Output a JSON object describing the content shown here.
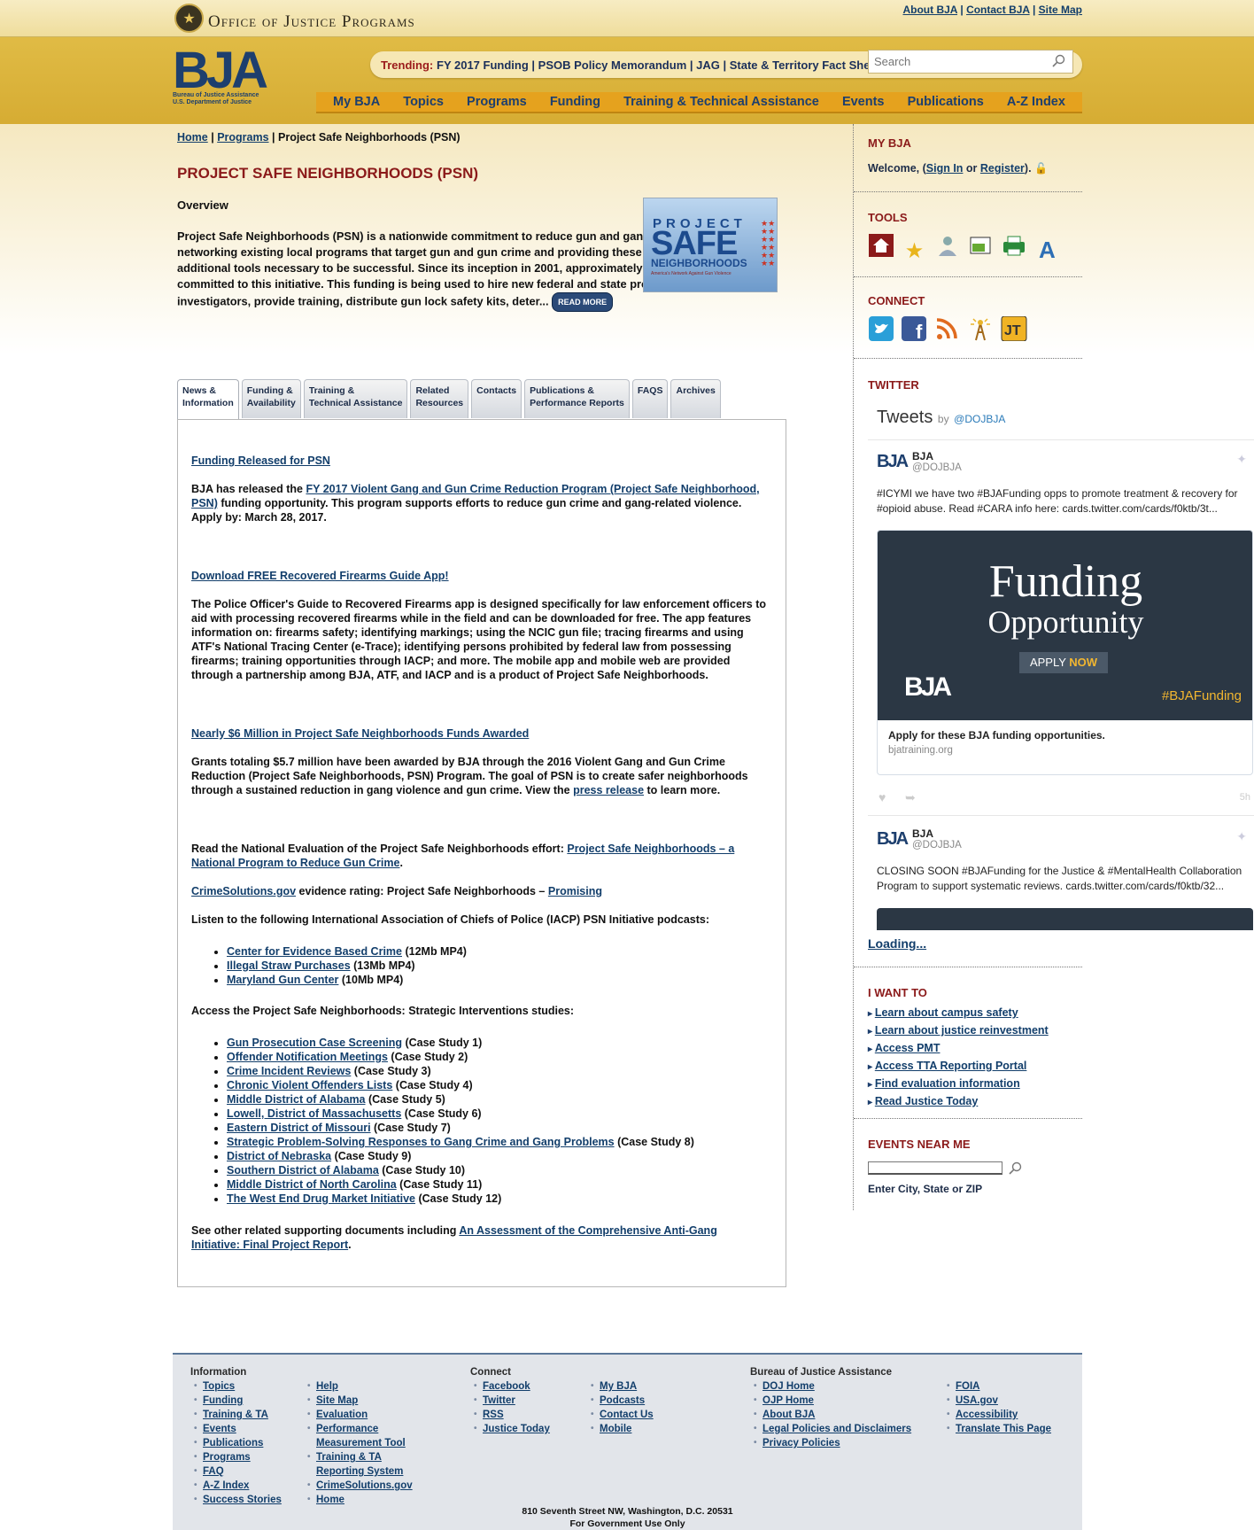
{
  "top": {
    "agency": "Office of Justice Programs",
    "links": [
      "About BJA",
      "Contact BJA",
      "Site Map"
    ]
  },
  "header": {
    "logo": "BJA",
    "logo_sub1": "Bureau of Justice Assistance",
    "logo_sub2": "U.S. Department of Justice",
    "trending_label": "Trending:",
    "trending": [
      "FY 2017 Funding",
      "PSOB Policy Memorandum",
      "JAG",
      "State & Territory Fact Sheets"
    ],
    "search_placeholder": "Search",
    "nav": [
      "My BJA",
      "Topics",
      "Programs",
      "Funding",
      "Training & Technical Assistance",
      "Events",
      "Publications",
      "A-Z Index"
    ]
  },
  "breadcrumb": {
    "home": "Home",
    "programs": "Programs",
    "current": "Project Safe Neighborhoods (PSN)"
  },
  "page_title": "PROJECT SAFE NEIGHBORHOODS (PSN)",
  "overview": {
    "label": "Overview",
    "text": "Project Safe Neighborhoods (PSN) is a nationwide commitment to reduce gun and gang crime in America by networking existing local programs that target gun and gun crime and providing these programs with additional tools necessary to be successful. Since its inception in 2001, approximately $2 billion has been committed to this initiative. This funding is being used to hire new federal and state prosecutors, support investigators, provide training, distribute gun lock safety kits, deter...",
    "read_more": "READ MORE"
  },
  "psn_logo": {
    "line1": "PROJECT",
    "line2": "SAFE",
    "line3": "NEIGHBORHOODS",
    "tagline": "America's Network Against Gun Violence"
  },
  "tabs": [
    {
      "l1": "News &",
      "l2": "Information"
    },
    {
      "l1": "Funding &",
      "l2": "Availability"
    },
    {
      "l1": "Training &",
      "l2": "Technical Assistance"
    },
    {
      "l1": "Related",
      "l2": "Resources"
    },
    {
      "l1": "Contacts",
      "l2": ""
    },
    {
      "l1": "Publications &",
      "l2": "Performance Reports"
    },
    {
      "l1": "FAQS",
      "l2": ""
    },
    {
      "l1": "Archives",
      "l2": ""
    }
  ],
  "news": {
    "item1_title": "Funding Released for PSN",
    "item1_pre": "BJA has released the ",
    "item1_link": "FY 2017 Violent Gang and Gun Crime Reduction Program (Project Safe Neighborhood, PSN)",
    "item1_post": " funding opportunity. This program supports efforts to reduce gun crime and gang-related violence. Apply by: March 28, 2017.",
    "item2_title": "Download FREE Recovered Firearms Guide App!",
    "item2_text": "The Police Officer's Guide to Recovered Firearms app is designed specifically for law enforcement officers to aid with processing recovered firearms while in the field and can be downloaded for free. The app features information on: firearms safety; identifying markings; using the NCIC gun file; tracing firearms and using ATF's National Tracing Center (e-Trace); identifying persons prohibited by federal law from possessing firearms; training opportunities through IACP; and more. The mobile app and mobile web are provided through a partnership among BJA, ATF, and IACP and is a product of Project Safe Neighborhoods.",
    "item3_title": "Nearly $6 Million in Project Safe Neighborhoods Funds Awarded",
    "item3_pre": "Grants totaling $5.7 million have been awarded by BJA through the 2016 Violent Gang and Gun Crime Reduction (Project Safe Neighborhoods, PSN) Program. The goal of PSN is to create safer neighborhoods through a sustained reduction in gang violence and gun crime. View the ",
    "item3_link": "press release",
    "item3_post": " to learn more.",
    "eval_pre": "Read the National Evaluation of the Project Safe Neighborhoods effort: ",
    "eval_link": "Project Safe Neighborhoods – a National Program to Reduce Gun Crime",
    "eval_post": ".",
    "cs_link": "CrimeSolutions.gov",
    "cs_mid": " evidence rating: Project Safe Neighborhoods – ",
    "cs_rating": "Promising",
    "podcast_intro": "Listen to the following International Association of Chiefs of Police (IACP) PSN Initiative podcasts:",
    "podcasts": [
      {
        "link": "Center for Evidence Based Crime",
        "note": " (12Mb MP4)"
      },
      {
        "link": "Illegal Straw Purchases",
        "note": " (13Mb MP4)"
      },
      {
        "link": "Maryland Gun Center",
        "note": " (10Mb MP4)"
      }
    ],
    "studies_intro": "Access the Project Safe Neighborhoods: Strategic Interventions studies:",
    "studies": [
      {
        "link": "Gun Prosecution Case Screening",
        "note": " (Case Study 1)"
      },
      {
        "link": "Offender Notification Meetings",
        "note": " (Case Study 2)"
      },
      {
        "link": "Crime Incident Reviews",
        "note": " (Case Study 3)"
      },
      {
        "link": "Chronic Violent Offenders Lists",
        "note": " (Case Study 4)"
      },
      {
        "link": "Middle District of Alabama",
        "note": " (Case Study 5)"
      },
      {
        "link": "Lowell, District of Massachusetts",
        "note": " (Case Study 6)"
      },
      {
        "link": "Eastern District of Missouri",
        "note": " (Case Study 7)"
      },
      {
        "link": "Strategic Problem-Solving Responses to Gang Crime and Gang Problems",
        "note": " (Case Study 8)"
      },
      {
        "link": "District of Nebraska",
        "note": " (Case Study 9)"
      },
      {
        "link": "Southern District of Alabama",
        "note": " (Case Study 10)"
      },
      {
        "link": "Middle District of North Carolina",
        "note": " (Case Study 11)"
      },
      {
        "link": "The West End Drug Market Initiative",
        "note": " (Case Study 12)"
      }
    ],
    "related_pre": "See other related supporting documents including ",
    "related_link": "An Assessment of the Comprehensive Anti-Gang Initiative: Final Project Report",
    "related_post": "."
  },
  "sidebar": {
    "mybja_title": "MY BJA",
    "welcome": "Welcome, (",
    "sign_in": "Sign In",
    "or": " or ",
    "register": "Register",
    "welcome_end": ").",
    "tools_title": "TOOLS",
    "connect_title": "CONNECT",
    "twitter_title": "TWITTER",
    "tweets_label": "Tweets",
    "tweets_by": "by",
    "tweets_handle": "@DOJBJA",
    "tweet1_name": "BJA",
    "tweet1_handle": "@DOJBJA",
    "tweet1_text": "#ICYMI we have two #BJAFunding opps to promote treatment & recovery for #opioid abuse. Read #CARA info here: cards.twitter.com/cards/f0ktb/3t...",
    "card_title1": "Funding",
    "card_title2": "Opportunity",
    "card_apply": "APPLY ",
    "card_now": "NOW",
    "card_logo": "BJA",
    "card_tag": "#BJAFunding",
    "card_caption": "Apply for these BJA funding opportunities.",
    "card_domain": "bjatraining.org",
    "tweet1_time": "5h",
    "tweet2_name": "BJA",
    "tweet2_handle": "@DOJBJA",
    "tweet2_text": "CLOSING SOON #BJAFunding for the Justice & #MentalHealth Collaboration Program to support systematic reviews. cards.twitter.com/cards/f0ktb/32...",
    "loading": "Loading...",
    "iwant_title": "I WANT TO",
    "iwant": [
      "Learn about campus safety",
      "Learn about justice reinvestment",
      "Access PMT",
      "Access TTA Reporting Portal",
      "Find evaluation information",
      "Read Justice Today"
    ],
    "events_title": "EVENTS NEAR ME",
    "events_hint": "Enter City, State or ZIP"
  },
  "footer": {
    "info_title": "Information",
    "info_col1": [
      "Topics",
      "Funding",
      "Training & TA",
      "Events",
      "Publications",
      "Programs",
      "FAQ",
      "A-Z Index",
      "Success Stories"
    ],
    "info_col2": [
      "Help",
      "Site Map",
      "Evaluation",
      "Performance Measurement Tool",
      "Training & TA Reporting System",
      "CrimeSolutions.gov",
      "Home"
    ],
    "connect_title": "Connect",
    "connect_col1": [
      "Facebook",
      "Twitter",
      "RSS",
      "Justice Today"
    ],
    "connect_col2": [
      "My BJA",
      "Podcasts",
      "Contact Us",
      "Mobile"
    ],
    "bja_title": "Bureau of Justice Assistance",
    "bja_col1": [
      "DOJ Home",
      "OJP Home",
      "About BJA",
      "Legal Policies and Disclaimers",
      "Privacy Policies"
    ],
    "bja_col2": [
      "FOIA",
      "USA.gov",
      "Accessibility",
      "Translate This Page"
    ],
    "address": "810 Seventh Street NW, Washington, D.C. 20531",
    "gov_use": "For Government Use Only"
  }
}
